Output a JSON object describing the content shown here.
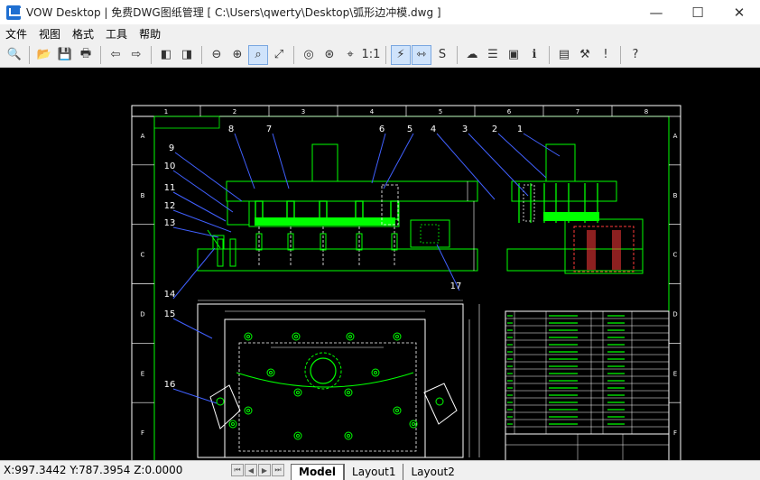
{
  "window": {
    "title": "VOW Desktop | 免费DWG图纸管理 [ C:\\Users\\qwerty\\Desktop\\弧形边冲模.dwg ]",
    "minimize": "—",
    "maximize": "☐",
    "close": "✕"
  },
  "menu": {
    "items": [
      "文件",
      "视图",
      "格式",
      "工具",
      "帮助"
    ]
  },
  "drawing": {
    "col_labels": [
      "1",
      "2",
      "3",
      "4",
      "5",
      "6",
      "7",
      "8"
    ],
    "row_labels": [
      "A",
      "B",
      "C",
      "D",
      "E",
      "F"
    ],
    "balloons": [
      "9",
      "10",
      "11",
      "12",
      "13",
      "14",
      "15",
      "16",
      "8",
      "7",
      "6",
      "5",
      "4",
      "3",
      "2",
      "1",
      "17"
    ],
    "accent_line": "#00ff00",
    "frame_color": "#ffffff",
    "leader_color": "#4060ff"
  },
  "status": {
    "coords": "X:997.3442 Y:787.3954 Z:0.0000",
    "tabs": [
      "Model",
      "Layout1",
      "Layout2"
    ]
  }
}
